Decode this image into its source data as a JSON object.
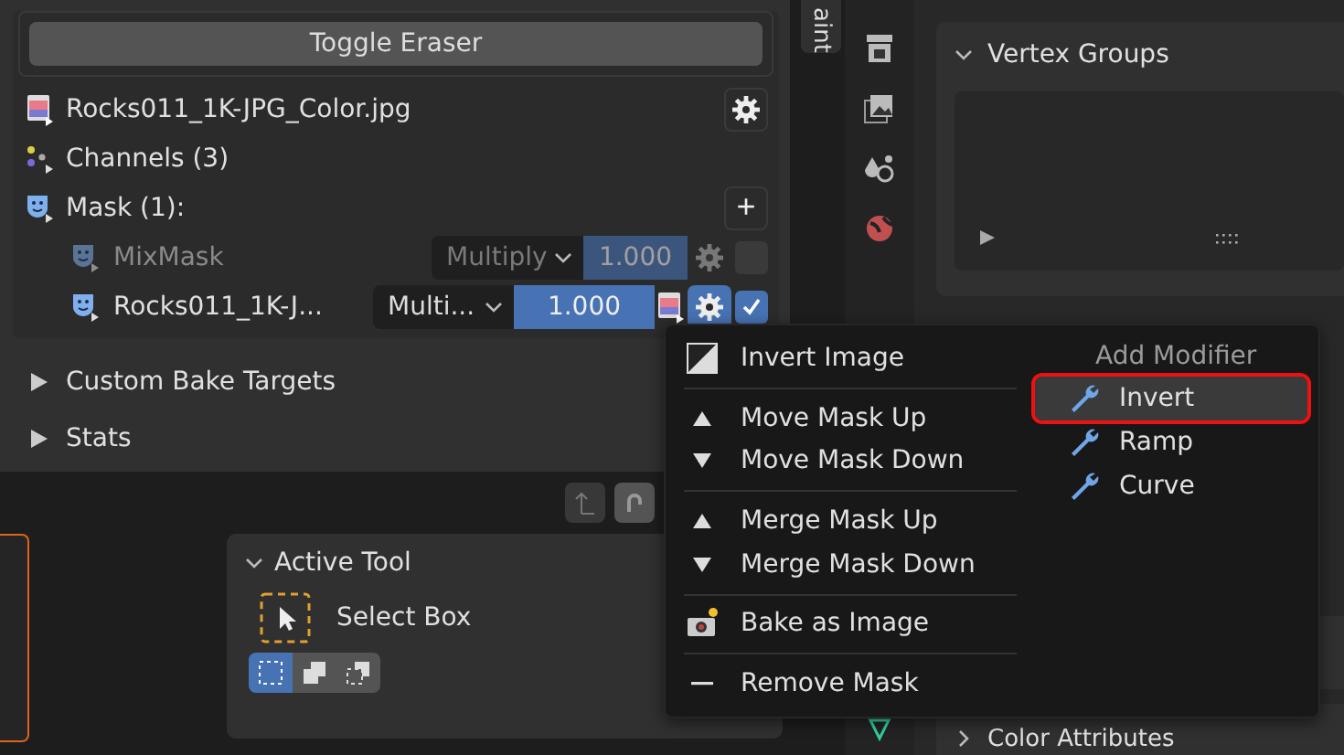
{
  "toggle_button": "Toggle Eraser",
  "image_row": {
    "label": "Rocks011_1K-JPG_Color.jpg"
  },
  "channels": {
    "label": "Channels (3)"
  },
  "mask_header": {
    "label": "Mask (1):",
    "add": "+"
  },
  "masks": [
    {
      "name": "MixMask",
      "blend": "Multiply",
      "value": "1.000",
      "level": 1,
      "enabled": false,
      "has_image": false,
      "menu_open": false
    },
    {
      "name": "Rocks011_1K-J...",
      "blend": "Multi...",
      "value": "1.000",
      "level": 1,
      "enabled": true,
      "has_image": true,
      "menu_open": true
    }
  ],
  "panels": [
    {
      "label": "Custom Bake Targets",
      "expanded": false
    },
    {
      "label": "Stats",
      "expanded": false
    }
  ],
  "side_tab": "aint",
  "vertex_groups": {
    "title": "Vertex Groups",
    "expanded": true
  },
  "active_tool": {
    "title": "Active Tool",
    "expanded": true,
    "tool": "Select Box",
    "modes": [
      {
        "kind": "new",
        "selected": true
      },
      {
        "kind": "extend",
        "selected": false
      },
      {
        "kind": "subtract",
        "selected": false
      }
    ]
  },
  "context_menu": {
    "groups": [
      [
        {
          "kind": "invert",
          "label": "Invert Image"
        }
      ],
      [
        {
          "kind": "up",
          "label": "Move Mask Up"
        },
        {
          "kind": "down",
          "label": "Move Mask Down"
        }
      ],
      [
        {
          "kind": "up",
          "label": "Merge Mask Up"
        },
        {
          "kind": "down",
          "label": "Merge Mask Down"
        }
      ],
      [
        {
          "kind": "camera",
          "label": "Bake as Image"
        }
      ],
      [
        {
          "kind": "minus",
          "label": "Remove Mask"
        }
      ]
    ],
    "submenu": {
      "title": "Add Modifier",
      "items": [
        {
          "label": "Invert",
          "selected": true
        },
        {
          "label": "Ramp",
          "selected": false
        },
        {
          "label": "Curve",
          "selected": false
        }
      ]
    }
  },
  "color_attributes": {
    "label": "Color Attributes",
    "expanded": false
  }
}
